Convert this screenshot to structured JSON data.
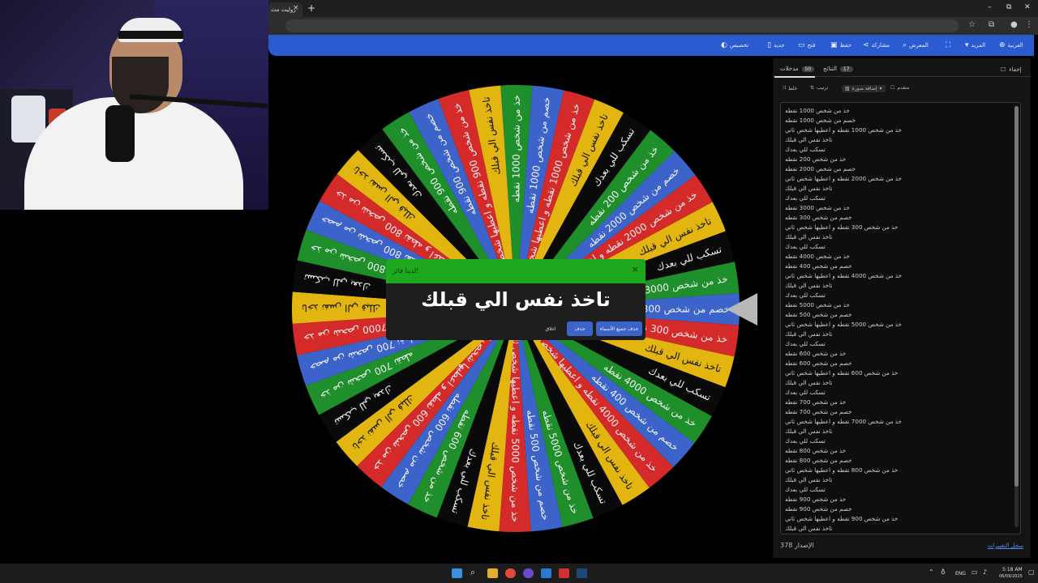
{
  "browser": {
    "tab_title": "رولیت مث",
    "tab_close": "×",
    "new_tab": "+",
    "win_min": "–",
    "win_max": "⧉",
    "win_close": "✕"
  },
  "toolbar": {
    "items": [
      {
        "label": "تخصيص",
        "icon": "palette-icon"
      },
      {
        "label": "جديد",
        "icon": "new-file-icon"
      },
      {
        "label": "فتح",
        "icon": "folder-icon"
      },
      {
        "label": "حفظ",
        "icon": "save-icon"
      },
      {
        "label": "مشاركة",
        "icon": "share-icon"
      },
      {
        "label": "المعرض",
        "icon": "search-icon"
      },
      {
        "label": "fullscreen",
        "icon": "fullscreen-icon"
      },
      {
        "label": "المزيد",
        "icon": "dropdown-icon"
      },
      {
        "label": "العربية",
        "icon": "globe-icon"
      }
    ],
    "color": "#2a5bd0"
  },
  "wheel": {
    "colors": [
      "#1e8f2a",
      "#3b63c9",
      "#d42a2a",
      "#e3b511",
      "#0a0a0a"
    ]
  },
  "dialog": {
    "title": "لدينا فائز!",
    "close": "×",
    "result": "تاخذ نفس الي قبلك",
    "btn_remove_all": "حذف جميع الأسماء",
    "btn_remove": "حذف",
    "btn_close": "اغلاق",
    "header_color": "#1ea81e"
  },
  "panel": {
    "hide_label": "إخفاء",
    "tab_entries": "مدخلات",
    "tab_entries_count": "50",
    "tab_results": "النتائج",
    "tab_results_count": "17",
    "tool_shuffle": "خلط",
    "tool_sort": "ترتيب",
    "tool_add_image": "إضافة صورة",
    "tool_advanced": "متقدم",
    "entries": [
      "خذ من شخص 1000 نقطه",
      "خصم من شخص 1000 نقطه",
      "خذ من شخص 1000 نقطه و اعطيها شخص ثاني",
      "تاخذ نفس الي قبلك",
      "تسكب للي بعدك",
      "خذ من شخص 200 نقطه",
      "خصم من شخص 2000 نقطه",
      "خذ من شخص 2000 نقطه و اعطيها شخص ثاني",
      "تاخذ نفس الي قبلك",
      "تسكب للي بعدك",
      "خذ من شخص 3000 نقطه",
      "خصم من شخص 300 نقطه",
      "خذ من شخص 300 نقطه و اعطيها شخص ثاني",
      "تاخذ نفس الي قبلك",
      "تسكب للي بعدك",
      "خذ من شخص 4000 نقطه",
      "خصم من شخص 400 نقطه",
      "خذ من شخص 4000 نقطه و اعطيها شخص ثاني",
      "تاخذ نفس الي قبلك",
      "تسكب للي بعدك",
      "خذ من شخص 5000 نقطه",
      "خصم من شخص 500 نقطه",
      "خذ من شخص 5000 نقطه و اعطيها شخص ثاني",
      "تاخذ نفس الي قبلك",
      "تسكب للي بعدك",
      "خذ من شخص 600 نقطه",
      "خصم من شخص 600 نقطه",
      "خذ من شخص 600 نقطه و اعطيها شخص ثاني",
      "تاخذ نفس الي قبلك",
      "تسكب للي بعدك",
      "خذ من شخص 700 نقطه",
      "خصم من شخص 700 نقطه",
      "خذ من شخص 7000 نقطه و اعطيها شخص ثاني",
      "تاخذ نفس الي قبلك",
      "تسكب للي بعدك",
      "خذ من شخص 800 نقطه",
      "خصم من شخص 800 نقطه",
      "خذ من شخص 800 نقطه و اعطيها شخص ثاني",
      "تاخذ نفس الي قبلك",
      "تسكب للي بعدك",
      "خذ من شخص 900 نقطه",
      "خصم من شخص 900 نقطه",
      "خذ من شخص 900 نقطه و اعطيها شخص ثاني",
      "تاخذ نفس الي قبلك"
    ],
    "count_label": "الإصدار 378",
    "history_link": "سجل التغييرات"
  },
  "taskbar": {
    "lang": "ENG",
    "time": "5:18 AM",
    "date": "06/09/2025"
  }
}
